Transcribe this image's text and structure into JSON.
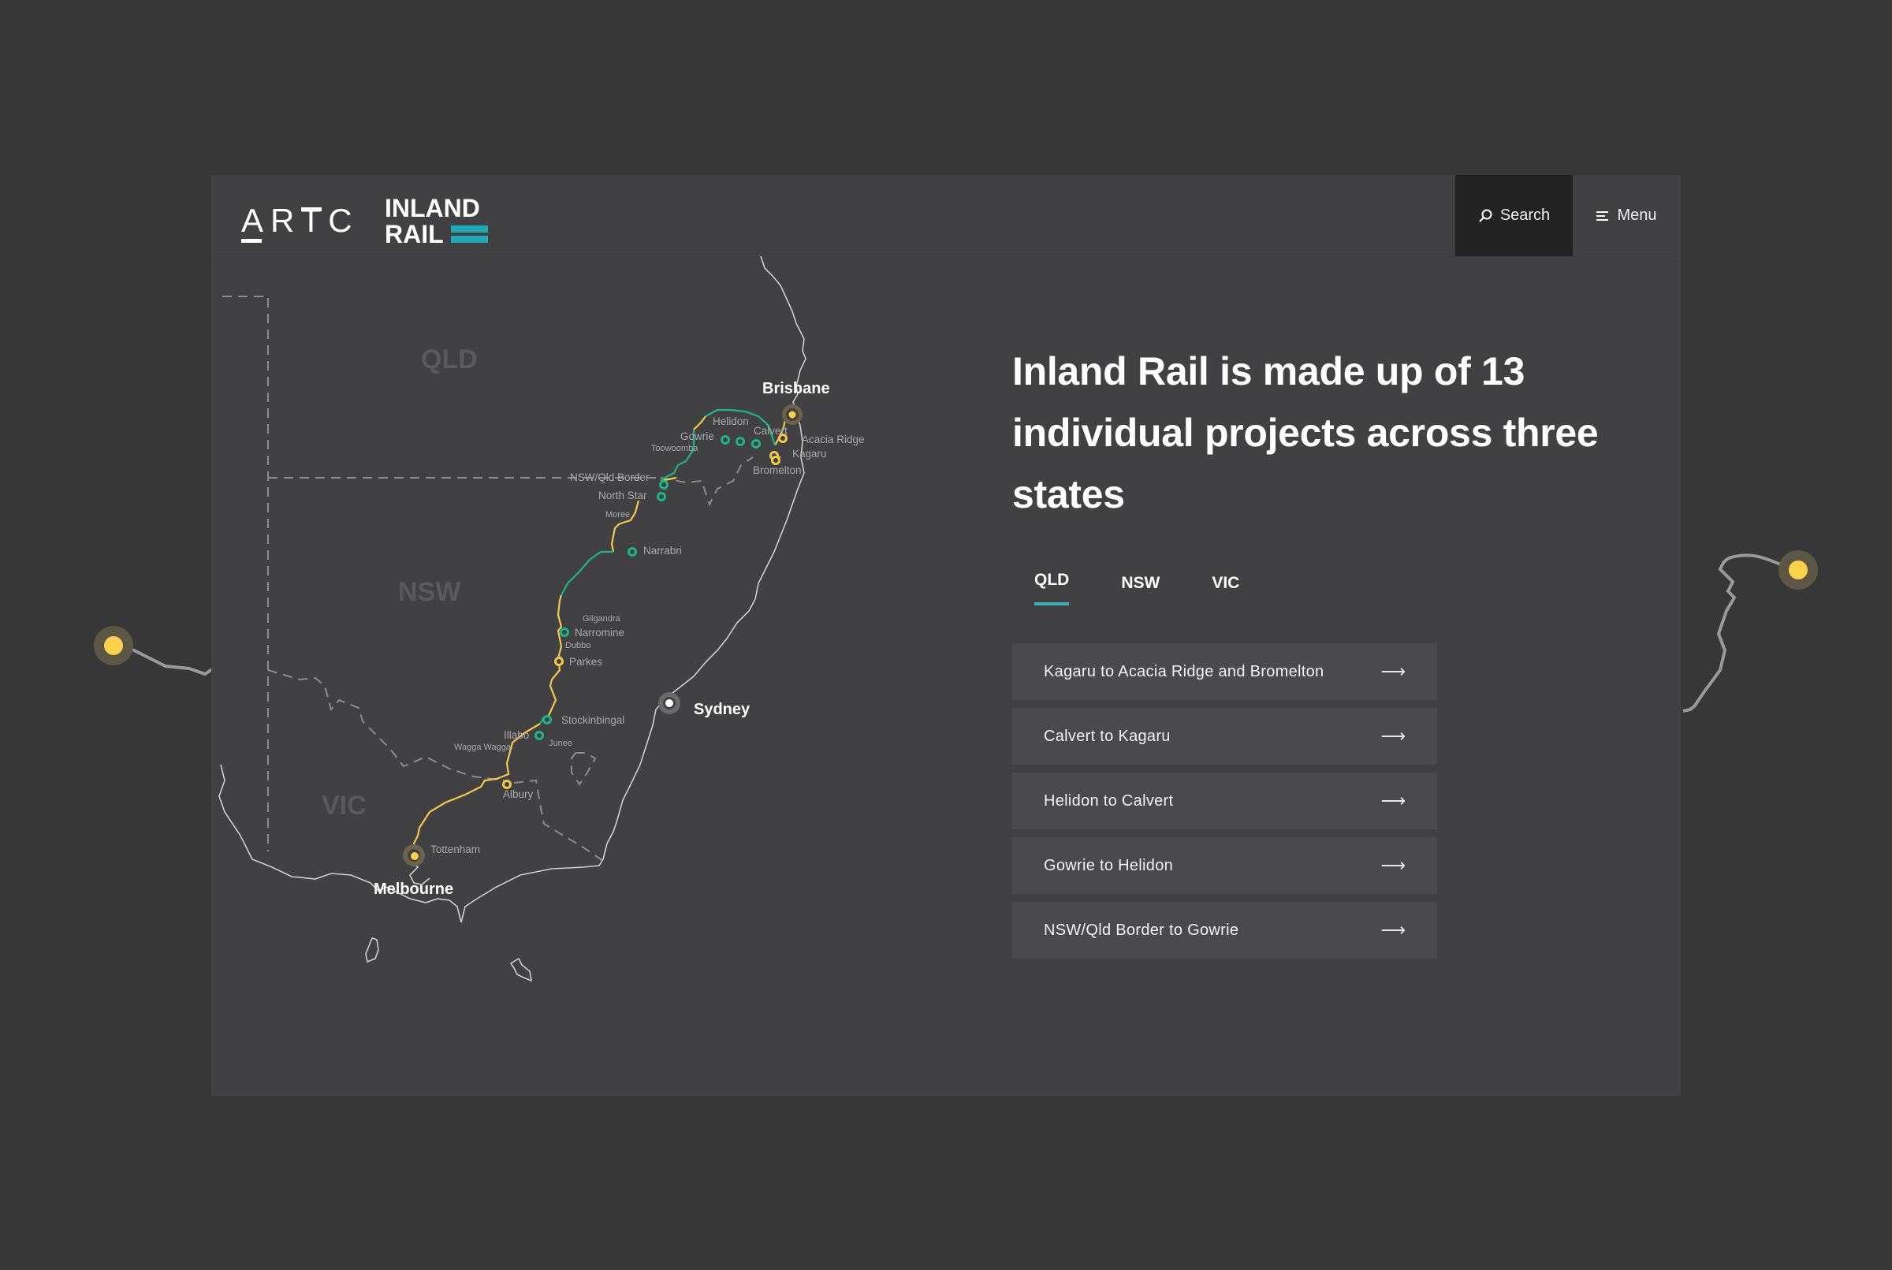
{
  "header": {
    "logo_artc": "ARTC",
    "logo_inland": "INLAND",
    "logo_rail": "RAIL",
    "search_label": "Search",
    "menu_label": "Menu",
    "search_icon": "search-icon",
    "menu_icon": "hamburger-icon"
  },
  "map": {
    "state_labels": [
      "QLD",
      "NSW",
      "VIC"
    ],
    "cities": [
      "Brisbane",
      "Sydney",
      "Melbourne"
    ],
    "places": {
      "helidon": "Helidon",
      "calvert": "Calvert",
      "gowrie": "Gowrie",
      "toowoomba": "Toowoomba",
      "acacia_ridge": "Acacia Ridge",
      "kagaru": "Kagaru",
      "bromelton": "Bromelton",
      "nsw_qld_border": "NSW/Qld Border",
      "north_star": "North Star",
      "moree": "Moree",
      "narrabri": "Narrabri",
      "gilgandra": "Gilgandra",
      "narromine": "Narromine",
      "dubbo": "Dubbo",
      "parkes": "Parkes",
      "stockinbingal": "Stockinbingal",
      "illabo": "Illabo",
      "wagga_wagga": "Wagga Wagga",
      "junee": "Junee",
      "albury": "Albury",
      "tottenham": "Tottenham"
    },
    "colors": {
      "new_track": "#1fb389",
      "upgrade_track": "#f2c94c",
      "accent": "#3ab1bd",
      "marker": "#fdd14b"
    }
  },
  "content": {
    "headline": "Inland Rail is made up of 13 individual projects across three states",
    "tabs": [
      {
        "label": "QLD",
        "active": true
      },
      {
        "label": "NSW",
        "active": false
      },
      {
        "label": "VIC",
        "active": false
      }
    ],
    "projects": [
      {
        "label": "Kagaru to Acacia Ridge and Bromelton",
        "arrow": "⟶"
      },
      {
        "label": "Calvert to Kagaru",
        "arrow": "⟶"
      },
      {
        "label": "Helidon to Calvert",
        "arrow": "⟶"
      },
      {
        "label": "Gowrie to Helidon",
        "arrow": "⟶"
      },
      {
        "label": "NSW/Qld Border to Gowrie",
        "arrow": "⟶"
      }
    ]
  }
}
